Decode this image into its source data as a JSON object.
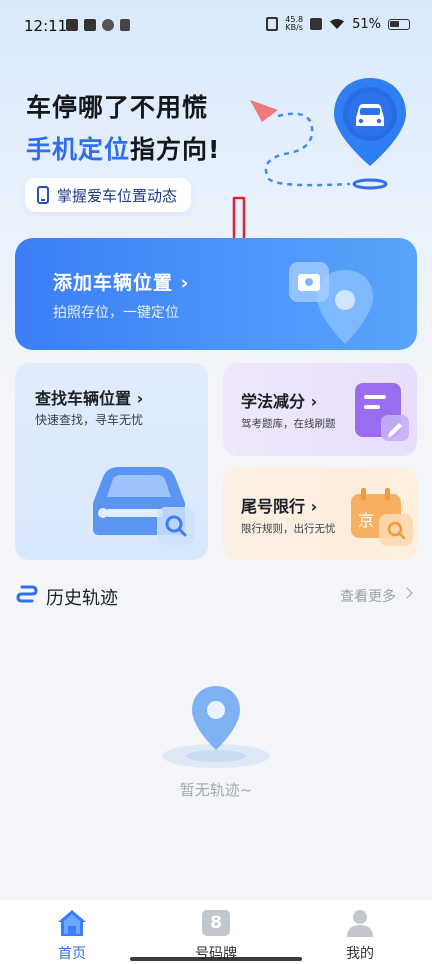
{
  "status_bar": {
    "time": "12:11",
    "net_speed_value": "45.8",
    "net_speed_unit": "KB/s",
    "battery": "51%"
  },
  "hero": {
    "line1": "车停哪了不用慌",
    "line2_highlight": "手机定位",
    "line2_rest": "指方向!",
    "pill_label": "掌握爱车位置动态"
  },
  "add_card": {
    "title": "添加车辆位置 ›",
    "subtitle": "拍照存位，一键定位"
  },
  "find_card": {
    "title": "查找车辆位置 ›",
    "subtitle": "快速查找，寻车无忧"
  },
  "study_card": {
    "title": "学法减分 ›",
    "subtitle": "驾考题库，在线刷题"
  },
  "tail_card": {
    "title": "尾号限行 ›",
    "subtitle": "限行规则，出行无忧",
    "badge_char": "京"
  },
  "history": {
    "title": "历史轨迹",
    "more": "查看更多",
    "empty_text": "暂无轨迹~"
  },
  "bottom_nav": {
    "items": [
      {
        "label": "首页",
        "icon": "home-icon",
        "active": true
      },
      {
        "label": "号码牌",
        "icon": "plate-icon",
        "plate_char": "8",
        "active": false
      },
      {
        "label": "我的",
        "icon": "profile-icon",
        "active": false
      }
    ]
  },
  "colors": {
    "accent": "#2f6ef0",
    "add_card_start": "#3b7ef7",
    "add_card_end": "#5aa5fb",
    "annotation_arrow": "#e0242a"
  }
}
